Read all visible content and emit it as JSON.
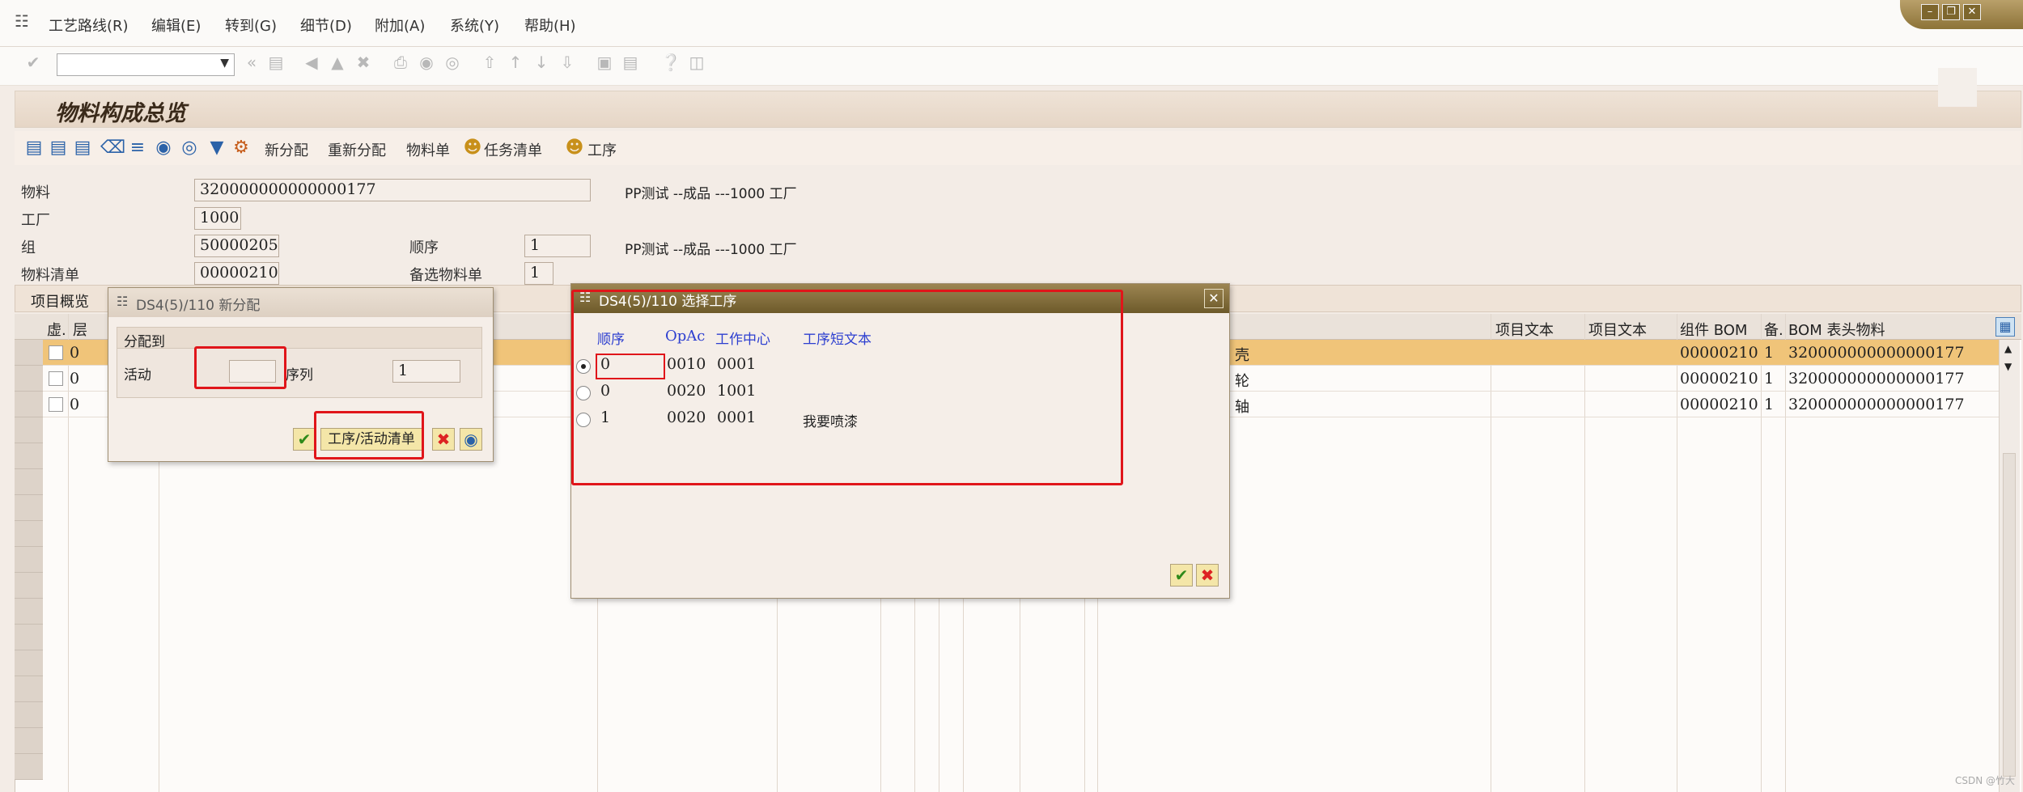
{
  "menu": {
    "items": [
      "工艺路线(R)",
      "编辑(E)",
      "转到(G)",
      "细节(D)",
      "附加(A)",
      "系统(Y)",
      "帮助(H)"
    ]
  },
  "toolbar": {
    "command_value": ""
  },
  "page": {
    "title": "物料构成总览"
  },
  "app_toolbar": {
    "new_assign": "新分配",
    "reassign": "重新分配",
    "bom": "物料单",
    "task_list": "任务清单",
    "operation": "工序"
  },
  "header": {
    "material_label": "物料",
    "material_value": "320000000000000177",
    "material_desc": "PP测试 --成品 ---1000 工厂",
    "plant_label": "工厂",
    "plant_value": "1000",
    "group_label": "组",
    "group_value": "50000205",
    "seq_label": "顺序",
    "seq_value": "1",
    "group_desc": "PP测试 --成品 ---1000 工厂",
    "bom_label": "物料清单",
    "bom_value": "00000210",
    "alt_bom_label": "备选物料单",
    "alt_bom_value": "1"
  },
  "items_tab": "项目概览",
  "grid": {
    "headers": {
      "virtual": "虚.",
      "level": "层",
      "item_text1": "项目文本",
      "item_text2": "项目文本",
      "component_bom": "组件 BOM",
      "alt": "备.",
      "bom_header_material": "BOM 表头物料"
    },
    "rows": [
      {
        "level": "0",
        "desc": "壳",
        "component_bom": "00000210",
        "alt": "1",
        "header_material": "320000000000000177"
      },
      {
        "level": "0",
        "desc": "轮",
        "component_bom": "00000210",
        "alt": "1",
        "header_material": "320000000000000177"
      },
      {
        "level": "0",
        "desc": "轴",
        "component_bom": "00000210",
        "alt": "1",
        "header_material": "320000000000000177"
      }
    ]
  },
  "dialog_assign": {
    "title": "DS4(5)/110 新分配",
    "group_label": "分配到",
    "activity_label": "活动",
    "activity_value": "",
    "seq_label": "序列",
    "seq_value": "1",
    "op_list_button": "工序/活动清单"
  },
  "dialog_select": {
    "title": "DS4(5)/110 选择工序",
    "columns": {
      "seq": "顺序",
      "opac": "OpAc",
      "workcenter": "工作中心",
      "short_text": "工序短文本"
    },
    "rows": [
      {
        "selected": true,
        "seq": "0",
        "opac": "0010",
        "workcenter": "0001",
        "short_text": ""
      },
      {
        "selected": false,
        "seq": "0",
        "opac": "0020",
        "workcenter": "1001",
        "short_text": ""
      },
      {
        "selected": false,
        "seq": "1",
        "opac": "0020",
        "workcenter": "0001",
        "short_text": "我要喷漆"
      }
    ]
  },
  "watermark": "CSDN @竹大"
}
